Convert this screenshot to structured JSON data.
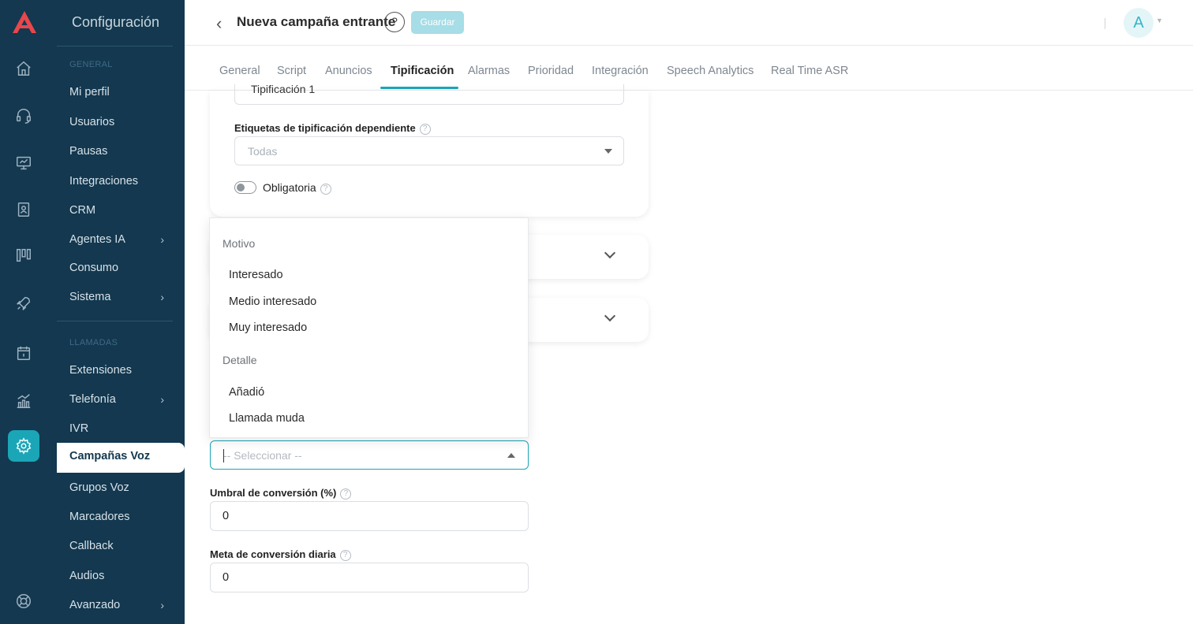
{
  "brand": {
    "accent": "#1aa6b7",
    "sidebar_bg": "#13384f",
    "logo_color": "#e8474b"
  },
  "sidebar": {
    "title": "Configuración",
    "sections": [
      {
        "label": "GENERAL"
      },
      {
        "label": "LLAMADAS"
      }
    ],
    "general_items": [
      {
        "label": "Mi perfil"
      },
      {
        "label": "Usuarios"
      },
      {
        "label": "Pausas"
      },
      {
        "label": "Integraciones"
      },
      {
        "label": "CRM"
      },
      {
        "label": "Agentes IA"
      },
      {
        "label": "Consumo"
      },
      {
        "label": "Sistema"
      }
    ],
    "llamadas_items": [
      {
        "label": "Extensiones"
      },
      {
        "label": "Telefonía"
      },
      {
        "label": "IVR"
      },
      {
        "label": "Campañas Voz"
      },
      {
        "label": "Grupos Voz"
      },
      {
        "label": "Marcadores"
      },
      {
        "label": "Callback"
      },
      {
        "label": "Audios"
      },
      {
        "label": "Avanzado"
      }
    ]
  },
  "rail_icons": [
    "home-icon",
    "headset-icon",
    "monitor-icon",
    "contact-book-icon",
    "kanban-icon",
    "rocket-icon",
    "calendar-icon",
    "chart-icon",
    "settings-icon",
    "help-ring-icon"
  ],
  "header": {
    "title": "Nueva campaña entrante",
    "help": "?",
    "save_label": "Guardar",
    "avatar_letter": "A"
  },
  "tabs": [
    {
      "label": "General"
    },
    {
      "label": "Script"
    },
    {
      "label": "Anuncios"
    },
    {
      "label": "Tipificación"
    },
    {
      "label": "Alarmas"
    },
    {
      "label": "Prioridad"
    },
    {
      "label": "Integración"
    },
    {
      "label": "Speech Analytics"
    },
    {
      "label": "Real Time ASR"
    }
  ],
  "card": {
    "top_select_value": "Tipificación 1",
    "dependent_label": "Etiquetas de tipificación dependiente",
    "dependent_placeholder": "Todas",
    "mandatory_label": "Obligatoria",
    "mandatory_on": false
  },
  "dropdown": {
    "group1": "Motivo",
    "group1_options": [
      "Interesado",
      "Medio interesado",
      "Muy interesado"
    ],
    "group2": "Detalle",
    "group2_options": [
      "Añadió",
      "Llamada muda"
    ]
  },
  "select_placeholder": "-- Seleccionar --",
  "conversion_threshold": {
    "label": "Umbral de conversión (%)",
    "value": "0"
  },
  "daily_goal": {
    "label": "Meta de conversión diaria",
    "value": "0"
  }
}
